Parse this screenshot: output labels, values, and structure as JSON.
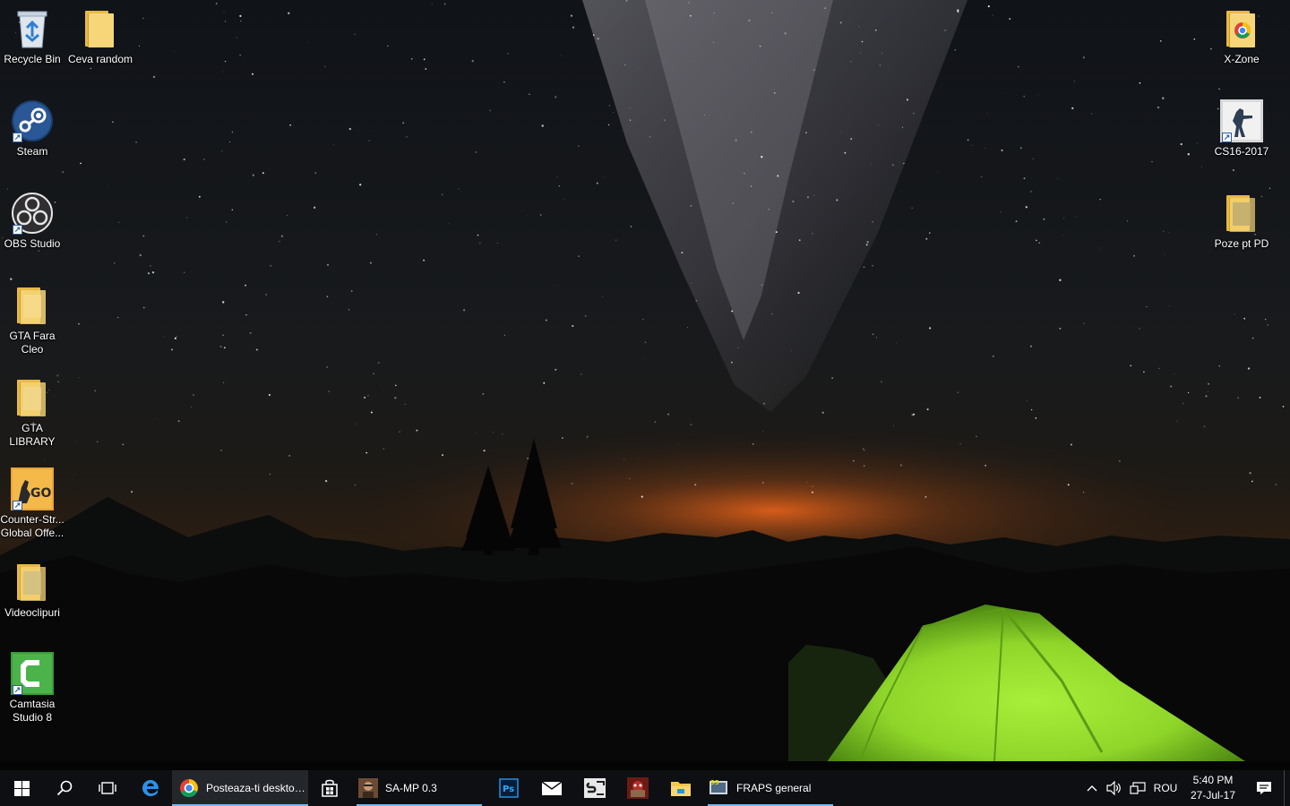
{
  "desktop": {
    "left_icons": [
      {
        "label": "Recycle Bin",
        "icon": "recycle-bin-icon"
      },
      {
        "label": "Ceva random",
        "icon": "folder-icon"
      },
      {
        "label": "Steam",
        "icon": "steam-icon"
      },
      {
        "label": "OBS Studio",
        "icon": "obs-icon"
      },
      {
        "label": "GTA Fara\nCleo",
        "icon": "folder-icon"
      },
      {
        "label": "GTA LIBRARY",
        "icon": "folder-icon"
      },
      {
        "label": "Counter-Str...\nGlobal Offe...",
        "icon": "csgo-icon"
      },
      {
        "label": "Videoclipuri",
        "icon": "folder-icon"
      },
      {
        "label": "Camtasia\nStudio 8",
        "icon": "camtasia-icon"
      }
    ],
    "right_icons": [
      {
        "label": "X-Zone",
        "icon": "folder-icon"
      },
      {
        "label": "CS16-2017",
        "icon": "cs16-icon"
      },
      {
        "label": "Poze pt PD",
        "icon": "folder-icon"
      }
    ]
  },
  "taskbar": {
    "apps": [
      {
        "label": "Posteaza-ti desktop...",
        "icon": "chrome-icon"
      },
      {
        "label": "SA-MP 0.3",
        "icon": "samp-icon"
      },
      {
        "label": "FRAPS general",
        "icon": "fraps-icon"
      }
    ],
    "pinned": [
      "edge-icon",
      "store-icon",
      "photoshop-icon",
      "mail-icon",
      "samp-browser-icon",
      "game-icon",
      "file-explorer-icon"
    ],
    "tray": {
      "language": "ROU",
      "time": "5:40 PM",
      "date": "27-Jul-17"
    }
  },
  "colors": {
    "taskbar_bg": "#0d0f12",
    "accent_underline": "#76b9ed",
    "tent_green": "#8fd62a",
    "horizon_glow": "#e0601a"
  }
}
